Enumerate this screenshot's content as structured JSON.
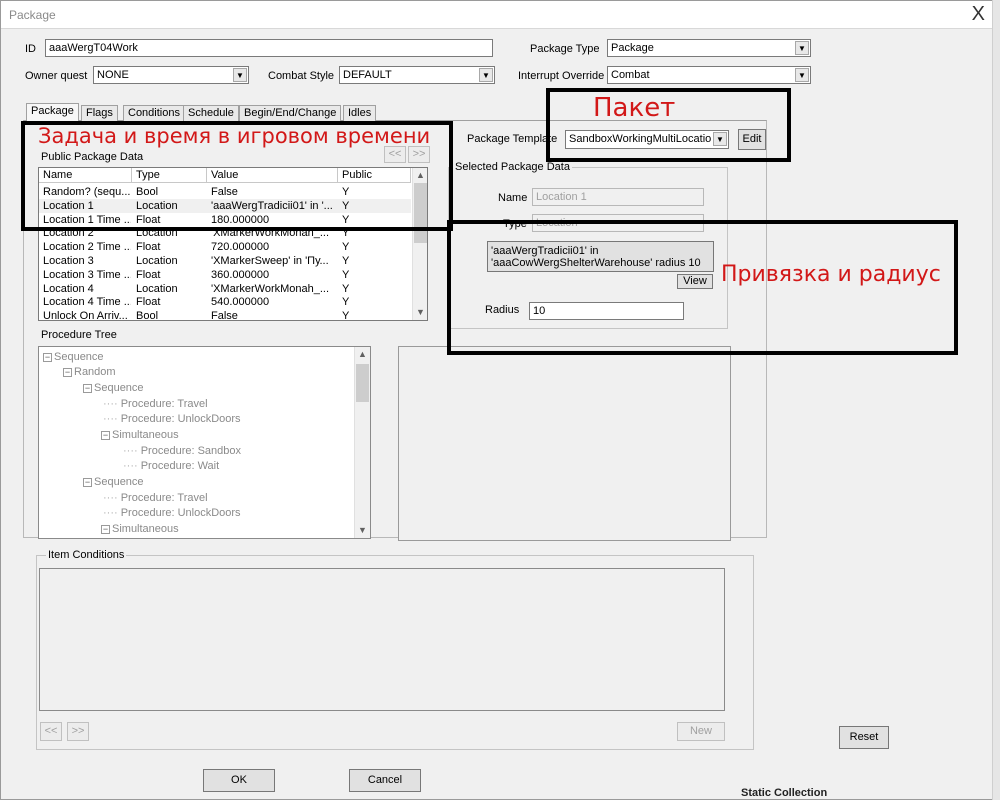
{
  "window": {
    "title": "Package",
    "close": "X"
  },
  "top": {
    "id_label": "ID",
    "id_value": "aaaWergT04Work",
    "owner_quest_label": "Owner quest",
    "owner_quest_value": "NONE",
    "combat_style_label": "Combat Style",
    "combat_style_value": "DEFAULT",
    "package_type_label": "Package Type",
    "package_type_value": "Package",
    "interrupt_override_label": "Interrupt Override",
    "interrupt_override_value": "Combat"
  },
  "tabs": [
    "Package",
    "Flags",
    "Conditions",
    "Schedule",
    "Begin/End/Change",
    "Idles"
  ],
  "public_data": {
    "title": "Public Package Data",
    "nav_prev": "<<",
    "nav_next": ">>",
    "columns": [
      "Name",
      "Type",
      "Value",
      "Public"
    ],
    "rows": [
      [
        "Random? (sequ...",
        "Bool",
        "False",
        "Y"
      ],
      [
        "Location 1",
        "Location",
        "'aaaWergTradicii01' in '...",
        "Y"
      ],
      [
        "Location 1 Time ...",
        "Float",
        "180.000000",
        "Y"
      ],
      [
        "Location 2",
        "Location",
        "'XMarkerWorkMonah_...",
        "Y"
      ],
      [
        "Location 2 Time ...",
        "Float",
        "720.000000",
        "Y"
      ],
      [
        "Location 3",
        "Location",
        "'XMarkerSweep' in 'Пу...",
        "Y"
      ],
      [
        "Location 3 Time ...",
        "Float",
        "360.000000",
        "Y"
      ],
      [
        "Location 4",
        "Location",
        "'XMarkerWorkMonah_...",
        "Y"
      ],
      [
        "Location 4 Time ...",
        "Float",
        "540.000000",
        "Y"
      ],
      [
        "Unlock On Arriv...",
        "Bool",
        "False",
        "Y"
      ]
    ]
  },
  "template": {
    "label": "Package Template",
    "value": "SandboxWorkingMultiLocation",
    "edit": "Edit"
  },
  "selected": {
    "title": "Selected Package Data",
    "name_label": "Name",
    "name_value": "Location 1",
    "type_label": "Type",
    "type_value": "Location",
    "location_button_line1": "'aaaWergTradicii01' in",
    "location_button_line2": "'aaaCowWergShelterWarehouse' radius 10",
    "view": "View",
    "radius_label": "Radius",
    "radius_value": "10"
  },
  "procedure": {
    "title": "Procedure Tree",
    "nodes": [
      "Sequence",
      "Random",
      "Sequence",
      "Procedure: Travel",
      "Procedure: UnlockDoors",
      "Simultaneous",
      "Procedure: Sandbox",
      "Procedure: Wait",
      "Sequence",
      "Procedure: Travel",
      "Procedure: UnlockDoors",
      "Simultaneous"
    ]
  },
  "item_conditions": {
    "title": "Item Conditions",
    "prev": "<<",
    "next": ">>",
    "new": "New"
  },
  "buttons": {
    "reset": "Reset",
    "ok": "OK",
    "cancel": "Cancel"
  },
  "annotations": {
    "task_time": "Задача и время в игровом времени",
    "package": "Пакет",
    "binding_radius": "Привязка и радиус",
    "color": "#d21818"
  },
  "background_hint": "Static Collection"
}
